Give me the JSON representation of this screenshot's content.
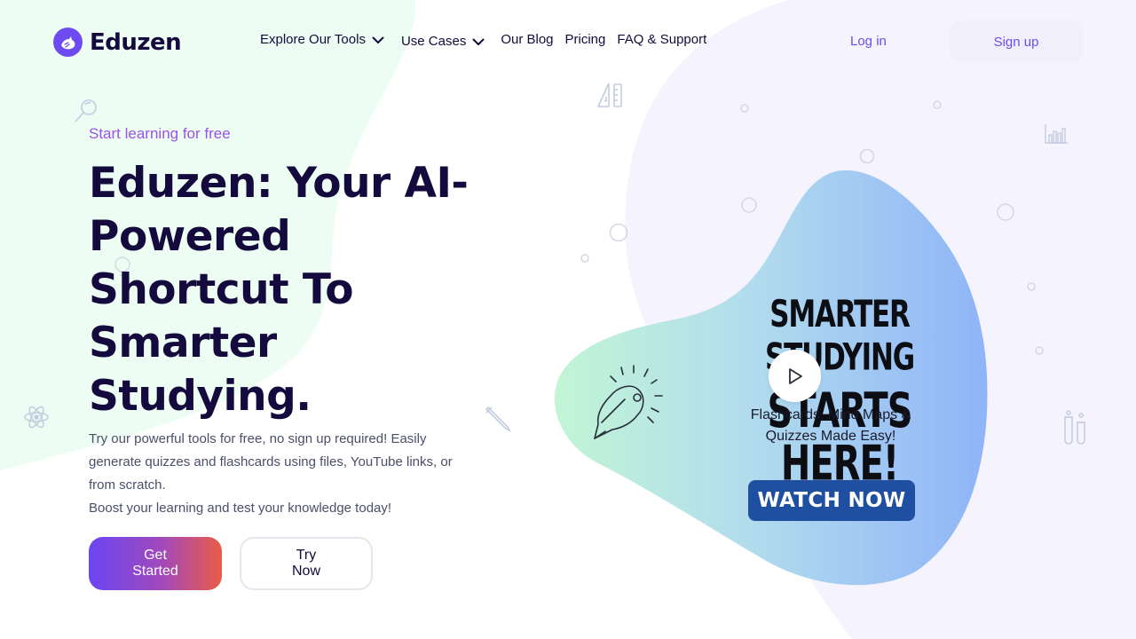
{
  "brand": {
    "name": "Eduzen",
    "accent": "#6d4bf0",
    "text_dark": "#140a3d"
  },
  "nav": {
    "items": [
      {
        "label": "Explore Our Tools",
        "has_dropdown": true
      },
      {
        "label": "Use Cases",
        "has_dropdown": true
      },
      {
        "label": "Our Blog",
        "has_dropdown": false
      },
      {
        "label": "Pricing",
        "has_dropdown": false
      },
      {
        "label": "FAQ & Support",
        "has_dropdown": false
      }
    ],
    "login": "Log in",
    "signup": "Sign up"
  },
  "hero": {
    "eyebrow": "Start learning for free",
    "title": "Eduzen: Your AI-Powered Shortcut To Smarter Studying.",
    "description_1": "Try our powerful tools for free, no sign up required! Easily generate quizzes and flashcards using files, YouTube links, or from scratch.",
    "description_2": "Boost your learning and test your knowledge today!",
    "primary_button": "Get Started",
    "secondary_button": "Try Now"
  },
  "video": {
    "headline_1": "SMARTER STUDYING",
    "headline_2": "STARTS HERE!",
    "subtext": "Flashcards, Mind Maps & Quizzes Made Easy!",
    "cta": "WATCH NOW",
    "play_icon": "play-icon"
  },
  "colors": {
    "green_bg": "#edfdf3",
    "lavender_bg": "#f5f3fd",
    "eyebrow": "#9a52e8",
    "watch_now_bg": "#1e4fa0",
    "button_gradient": [
      "#6a46f2",
      "#a249bb",
      "#ea5c46"
    ]
  }
}
